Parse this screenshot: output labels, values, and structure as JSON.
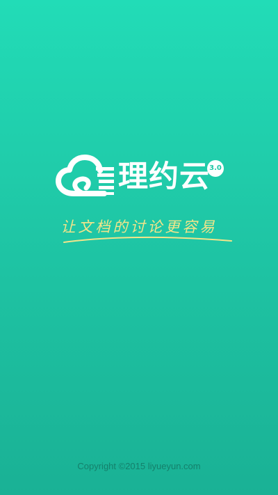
{
  "splash": {
    "brand_name": "理约云",
    "version": "3.0",
    "slogan": "让文档的讨论更容易",
    "copyright": "Copyright ©2015 liyueyun.com",
    "logo_icon": "cloud-document-icon"
  },
  "colors": {
    "background_top": "#22dcb7",
    "background_bottom": "#1ab195",
    "slogan": "#f3e58a",
    "logo": "#ffffff",
    "copyright": "#14806b"
  }
}
